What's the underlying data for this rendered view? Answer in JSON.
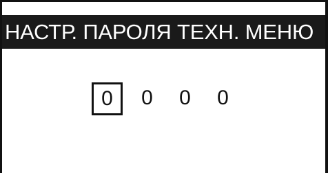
{
  "title": "НАСТР. ПАРОЛЯ ТЕХН. МЕНЮ",
  "password_digits": [
    "0",
    "0",
    "0",
    "0"
  ],
  "selected_digit_index": 0,
  "colors": {
    "title_background": "#1a1a1a",
    "title_text": "#ffffff",
    "screen_background": "#ffffff",
    "text": "#111111"
  }
}
